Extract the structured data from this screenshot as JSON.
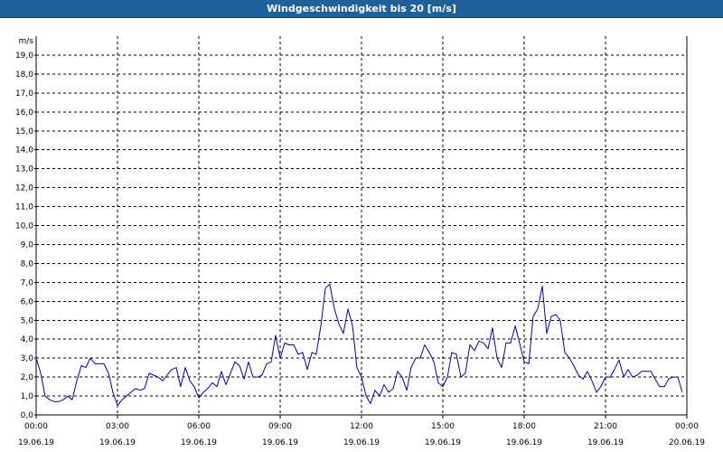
{
  "window": {
    "title": "Windgeschwindigkeit bis 20 [m/s]"
  },
  "colors": {
    "title_bar": "#1f5f9a",
    "series_line": "#0000aa",
    "grid": "#000000",
    "background": "#ffffff"
  },
  "chart_data": {
    "type": "line",
    "title": "Windgeschwindigkeit bis 20 [m/s]",
    "ylabel": "m/s",
    "xlabel": "",
    "ylim": [
      0,
      20
    ],
    "yticks": [
      "0,0",
      "1,0",
      "2,0",
      "3,0",
      "4,0",
      "5,0",
      "6,0",
      "7,0",
      "8,0",
      "9,0",
      "10,0",
      "11,0",
      "12,0",
      "13,0",
      "14,0",
      "15,0",
      "16,0",
      "17,0",
      "18,0",
      "19,0"
    ],
    "xlim_hours": [
      0,
      24
    ],
    "xticks": [
      {
        "time": "00:00",
        "date": "19.06.19"
      },
      {
        "time": "03:00",
        "date": "19.06.19"
      },
      {
        "time": "06:00",
        "date": "19.06.19"
      },
      {
        "time": "09:00",
        "date": "19.06.19"
      },
      {
        "time": "12:00",
        "date": "19.06.19"
      },
      {
        "time": "15:00",
        "date": "19.06.19"
      },
      {
        "time": "18:00",
        "date": "19.06.19"
      },
      {
        "time": "21:00",
        "date": "19.06.19"
      },
      {
        "time": "00:00",
        "date": "20.06.19"
      }
    ],
    "grid": true,
    "series": [
      {
        "x": [
          0,
          0.17,
          0.33,
          0.5,
          0.67,
          0.83,
          1.0,
          1.17,
          1.33,
          1.5,
          1.67,
          1.83,
          2.0,
          2.17,
          2.33,
          2.5,
          2.67,
          2.83,
          3.0,
          3.17,
          3.33,
          3.5,
          3.67,
          3.83,
          4.0,
          4.17,
          4.33,
          4.5,
          4.67,
          4.83,
          5.0,
          5.17,
          5.33,
          5.5,
          5.67,
          5.83,
          6.0,
          6.17,
          6.33,
          6.5,
          6.67,
          6.83,
          7.0,
          7.17,
          7.33,
          7.5,
          7.67,
          7.83,
          8.0,
          8.17,
          8.33,
          8.5,
          8.67,
          8.83,
          9.0,
          9.17,
          9.33,
          9.5,
          9.67,
          9.83,
          10.0,
          10.17,
          10.33,
          10.5,
          10.67,
          10.83,
          11.0,
          11.17,
          11.33,
          11.5,
          11.67,
          11.83,
          12.0,
          12.17,
          12.33,
          12.5,
          12.67,
          12.83,
          13.0,
          13.17,
          13.33,
          13.5,
          13.67,
          13.83,
          14.0,
          14.17,
          14.33,
          14.5,
          14.67,
          14.83,
          15.0,
          15.17,
          15.33,
          15.5,
          15.67,
          15.83,
          16.0,
          16.17,
          16.33,
          16.5,
          16.67,
          16.83,
          17.0,
          17.17,
          17.33,
          17.5,
          17.67,
          17.83,
          18.0,
          18.17,
          18.33,
          18.5,
          18.67,
          18.83,
          19.0,
          19.17,
          19.33,
          19.5,
          19.67,
          19.83,
          20.0,
          20.17,
          20.33,
          20.5,
          20.67,
          20.83,
          21.0,
          21.17,
          21.33,
          21.5,
          21.67,
          21.83,
          22.0,
          22.17,
          22.33,
          22.5,
          22.67,
          22.83,
          23.0,
          23.17,
          23.33,
          23.5,
          23.67,
          23.83
        ],
        "values": [
          3.0,
          2.2,
          1.0,
          0.8,
          0.7,
          0.7,
          0.8,
          1.0,
          0.8,
          1.8,
          2.6,
          2.5,
          3.0,
          2.7,
          2.7,
          2.7,
          2.2,
          1.2,
          0.5,
          0.8,
          1.0,
          1.2,
          1.4,
          1.3,
          1.4,
          2.2,
          2.1,
          2.0,
          1.8,
          2.1,
          2.4,
          2.5,
          1.5,
          2.5,
          1.8,
          1.5,
          0.9,
          1.2,
          1.4,
          1.7,
          1.5,
          2.3,
          1.6,
          2.2,
          2.8,
          2.6,
          1.9,
          2.8,
          2.0,
          2.0,
          2.1,
          2.7,
          2.8,
          4.2,
          3.0,
          3.8,
          3.7,
          3.7,
          3.2,
          3.3,
          2.4,
          3.3,
          3.2,
          4.7,
          6.7,
          6.9,
          5.6,
          4.8,
          4.3,
          5.6,
          4.7,
          2.5,
          2.0,
          1.0,
          0.6,
          1.3,
          1.0,
          1.6,
          1.2,
          1.4,
          2.3,
          2.0,
          1.3,
          2.5,
          3.0,
          3.0,
          3.7,
          3.3,
          2.8,
          1.7,
          1.5,
          2.0,
          3.3,
          3.2,
          2.0,
          2.2,
          3.7,
          3.4,
          3.9,
          3.8,
          3.5,
          4.6,
          3.0,
          2.5,
          3.8,
          3.8,
          4.7,
          3.8,
          2.8,
          2.7,
          5.2,
          5.6,
          6.8,
          4.3,
          5.2,
          5.3,
          5.0,
          3.3,
          3.0,
          2.6,
          2.1,
          1.9,
          2.3,
          1.8,
          1.2,
          1.5,
          2.0,
          2.0,
          2.4,
          2.9,
          2.0,
          2.4,
          2.0,
          2.1,
          2.3,
          2.3,
          2.3,
          1.9,
          1.5,
          1.5,
          1.9,
          2.0,
          2.0,
          1.2
        ]
      }
    ]
  }
}
